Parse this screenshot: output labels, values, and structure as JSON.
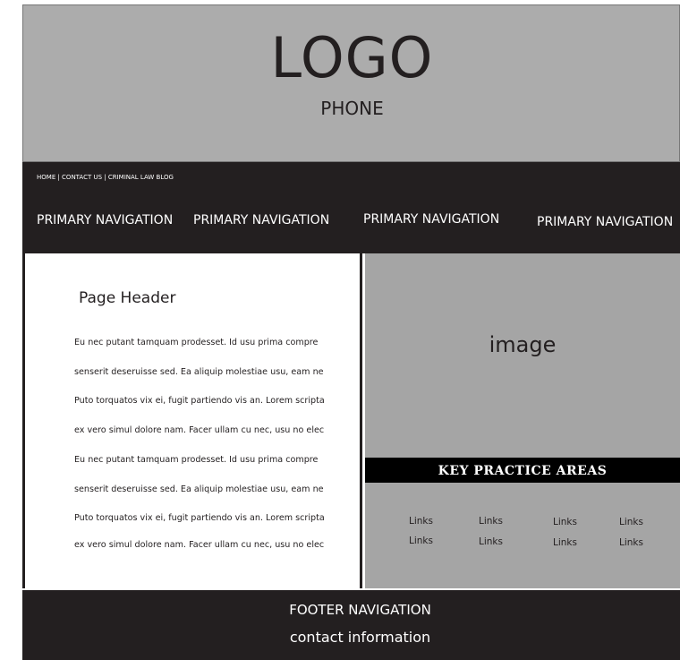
{
  "header": {
    "logo": "LOGO",
    "phone": "PHONE"
  },
  "utility_nav": "HOME | CONTACT US | CRIMINAL LAW BLOG",
  "primary_nav": [
    "PRIMARY NAVIGATION",
    "PRIMARY NAVIGATION",
    "PRIMARY NAVIGATION",
    "PRIMARY NAVIGATION"
  ],
  "content": {
    "page_header": "Page Header",
    "paragraph_lines": [
      "Eu nec putant tamquam prodesset. Id usu prima compre",
      "senserit deseruisse sed. Ea aliquip molestiae usu, eam ne",
      "Puto torquatos vix ei, fugit partiendo vis an. Lorem scripta",
      "ex vero simul dolore nam. Facer ullam cu nec, usu no elec",
      "Eu nec putant tamquam prodesset. Id usu prima compre",
      "senserit deseruisse sed. Ea aliquip molestiae usu, eam ne",
      "Puto torquatos vix ei, fugit partiendo vis an. Lorem scripta",
      "ex vero simul dolore nam. Facer ullam cu nec, usu no elec"
    ]
  },
  "image_placeholder": "image",
  "key_practice": {
    "title": "KEY PRACTICE AREAS",
    "links_row1": [
      "Links",
      "Links",
      "Links",
      "Links"
    ],
    "links_row2": [
      "Links",
      "Links",
      "Links",
      "Links"
    ]
  },
  "footer": {
    "navigation": "FOOTER NAVIGATION",
    "contact": "contact information"
  },
  "colors": {
    "header_bg": "#acacac",
    "dark": "#231f20",
    "panel_gray": "#a5a5a5",
    "kpa_bar": "#000000"
  }
}
